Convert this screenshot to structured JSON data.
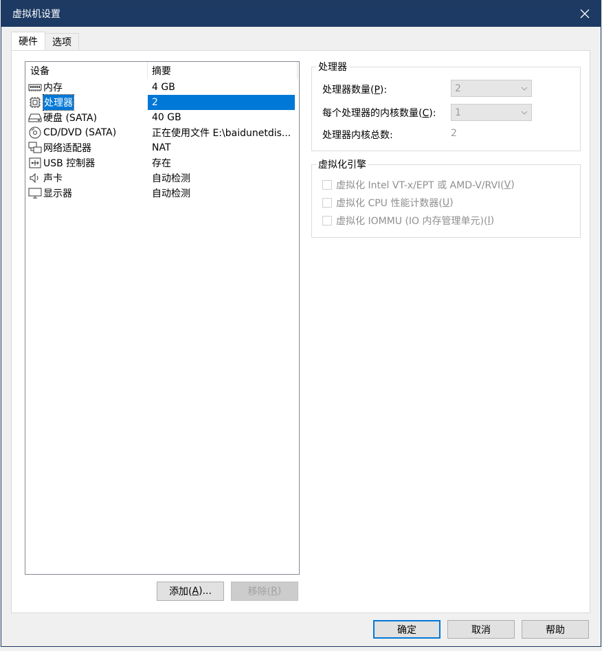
{
  "dialog": {
    "title": "虚拟机设置",
    "close_icon": "close-icon"
  },
  "tabs": [
    {
      "label": "硬件",
      "active": true
    },
    {
      "label": "选项",
      "active": false
    }
  ],
  "device_list": {
    "col_device": "设备",
    "col_summary": "摘要",
    "rows": [
      {
        "icon": "memory-icon",
        "name": "内存",
        "summary": "4 GB"
      },
      {
        "icon": "processor-icon",
        "name": "处理器",
        "summary": "2"
      },
      {
        "icon": "harddisk-icon",
        "name": "硬盘 (SATA)",
        "summary": "40 GB"
      },
      {
        "icon": "cdrom-icon",
        "name": "CD/DVD (SATA)",
        "summary": "正在使用文件 E:\\baidunetdis..."
      },
      {
        "icon": "network-adapter-icon",
        "name": "网络适配器",
        "summary": "NAT"
      },
      {
        "icon": "usb-icon",
        "name": "USB 控制器",
        "summary": "存在"
      },
      {
        "icon": "sound-icon",
        "name": "声卡",
        "summary": "自动检测"
      },
      {
        "icon": "display-icon",
        "name": "显示器",
        "summary": "自动检测"
      }
    ],
    "selected_index": 1
  },
  "list_buttons": {
    "add_prefix": "添加(",
    "add_key": "A",
    "add_suffix": ")...",
    "remove_prefix": "移除(",
    "remove_key": "R",
    "remove_suffix": ")"
  },
  "processor_group": {
    "legend": "处理器",
    "count_label_prefix": "处理器数量(",
    "count_label_key": "P",
    "count_label_suffix": "):",
    "count_value": "2",
    "cores_label_prefix": "每个处理器的内核数量(",
    "cores_label_key": "C",
    "cores_label_suffix": "):",
    "cores_value": "1",
    "total_label": "处理器内核总数:",
    "total_value": "2"
  },
  "virt_group": {
    "legend": "虚拟化引擎",
    "opt1_prefix": "虚拟化 Intel VT-x/EPT 或 AMD-V/RVI(",
    "opt1_key": "V",
    "opt1_suffix": ")",
    "opt2_prefix": "虚拟化 CPU 性能计数器(",
    "opt2_key": "U",
    "opt2_suffix": ")",
    "opt3_prefix": "虚拟化 IOMMU (IO 内存管理单元)(",
    "opt3_key": "I",
    "opt3_suffix": ")"
  },
  "footer": {
    "ok": "确定",
    "cancel": "取消",
    "help": "帮助"
  }
}
